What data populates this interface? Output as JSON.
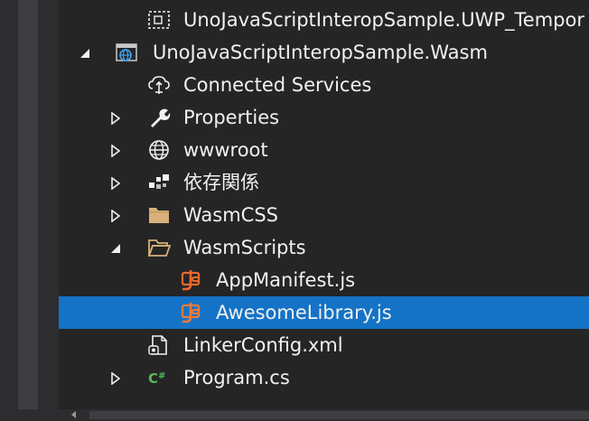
{
  "tree": {
    "items": [
      {
        "label": "UnoJavaScriptInteropSample.UWP_Tempor",
        "icon": "temp-project-icon",
        "expander": "none"
      },
      {
        "label": "UnoJavaScriptInteropSample.Wasm",
        "icon": "web-project-icon",
        "expander": "expanded"
      },
      {
        "label": "Connected Services",
        "icon": "cloud-services-icon",
        "expander": "none"
      },
      {
        "label": "Properties",
        "icon": "wrench-icon",
        "expander": "collapsed"
      },
      {
        "label": "wwwroot",
        "icon": "globe-icon",
        "expander": "collapsed"
      },
      {
        "label": "依存関係",
        "icon": "dependencies-icon",
        "expander": "collapsed"
      },
      {
        "label": "WasmCSS",
        "icon": "folder-icon",
        "expander": "collapsed"
      },
      {
        "label": "WasmScripts",
        "icon": "folder-open-icon",
        "expander": "expanded"
      },
      {
        "label": "AppManifest.js",
        "icon": "js-file-icon",
        "expander": "none"
      },
      {
        "label": "AwesomeLibrary.js",
        "icon": "js-file-icon",
        "expander": "none",
        "selected": true
      },
      {
        "label": "LinkerConfig.xml",
        "icon": "xml-file-icon",
        "expander": "none"
      },
      {
        "label": "Program.cs",
        "icon": "csharp-file-icon",
        "expander": "collapsed"
      }
    ]
  },
  "colors": {
    "background": "#252526",
    "selection": "#1473c6",
    "text": "#f1f1f1",
    "js_orange": "#e8692a",
    "folder_tan": "#d8b07a",
    "csharp_green": "#5db85d"
  }
}
